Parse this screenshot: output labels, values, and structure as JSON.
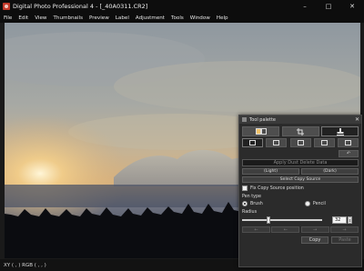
{
  "window": {
    "title": "Digital Photo Professional 4 - [_40A0311.CR2]",
    "minimize": "–",
    "maximize": "□",
    "close": "✕"
  },
  "menu": {
    "items": [
      "File",
      "Edit",
      "View",
      "Thumbnails",
      "Preview",
      "Label",
      "Adjustment",
      "Tools",
      "Window",
      "Help"
    ]
  },
  "status": {
    "text": "XY (   ,    ) RGB (   ,    ,    )"
  },
  "palette": {
    "title": "Tool palette",
    "close": "✕",
    "undo": "↶",
    "apply_dust_delete": "Apply Dust Delete Data",
    "light": "(Light)",
    "dark": "(Dark)",
    "select_copy_source": "Select Copy Source",
    "fix_copy_source": "Fix Copy Source position",
    "pen_type_label": "Pen type",
    "brush": "Brush",
    "pencil": "Pencil",
    "radius_label": "Radius",
    "radius_value": "32",
    "radius_slider_fraction": 0.32,
    "icon_buttons": [
      "←",
      "←",
      "→",
      "→"
    ],
    "copy": "Copy",
    "paste": "Paste"
  }
}
